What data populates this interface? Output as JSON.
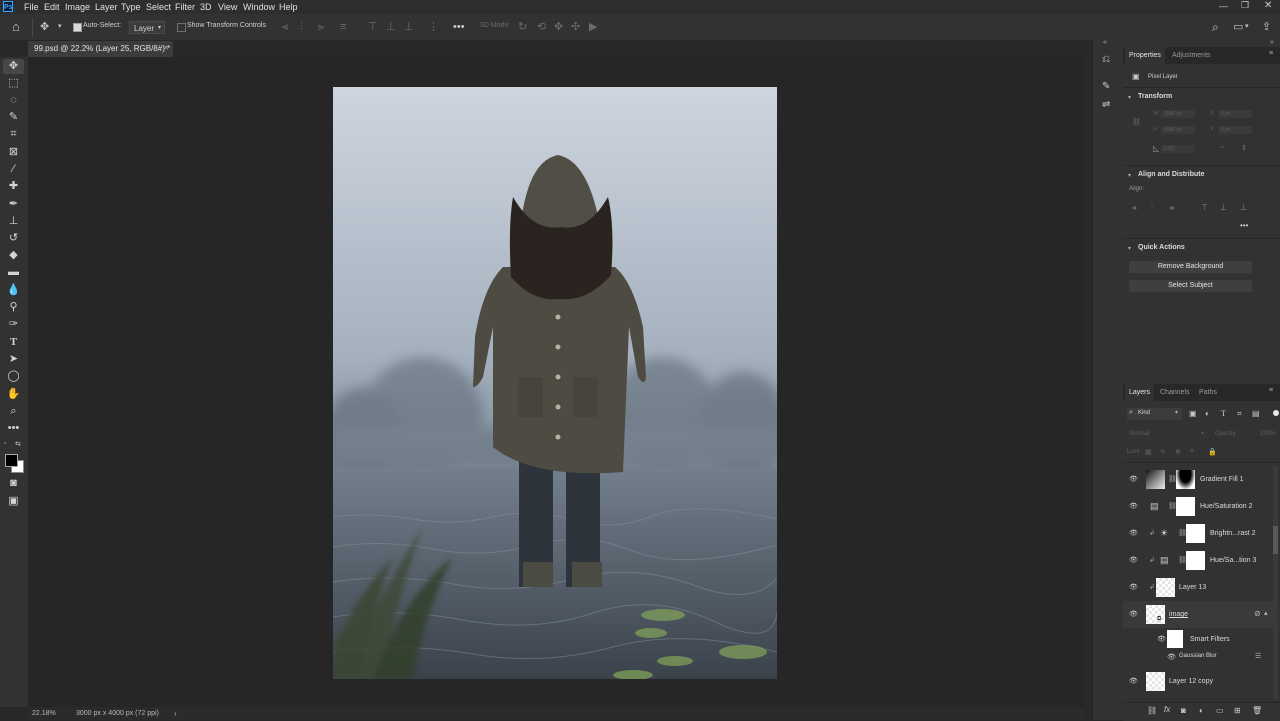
{
  "app": {
    "logo_text": "Ps"
  },
  "menu": [
    "File",
    "Edit",
    "Image",
    "Layer",
    "Type",
    "Select",
    "Filter",
    "3D",
    "View",
    "Window",
    "Help"
  ],
  "options_bar": {
    "auto_select_label": "Auto-Select:",
    "auto_select_target": "Layer",
    "show_transform_label": "Show Transform Controls",
    "three_d_mode_label": "3D Mode:"
  },
  "document": {
    "tab_title": "99.psd @ 22.2% (Layer 25, RGB/8#) *",
    "zoom_readout": "22.18%",
    "doc_size_readout": "3000 px x 4000 px (72 ppi)"
  },
  "properties_panel": {
    "tabs": [
      "Properties",
      "Adjustments"
    ],
    "layer_kind": "Pixel Layer",
    "transform_title": "Transform",
    "w_label": "W",
    "w_value": "3000 px",
    "h_label": "H",
    "h_value": "4000 px",
    "x_label": "X",
    "x_value": "0 px",
    "y_label": "Y",
    "y_value": "0 px",
    "angle_value": "0.00°",
    "align_title": "Align and Distribute",
    "align_label": "Align:",
    "quick_actions_title": "Quick Actions",
    "remove_bg_label": "Remove Background",
    "select_subject_label": "Select Subject"
  },
  "layers_panel": {
    "tabs": [
      "Layers",
      "Channels",
      "Paths"
    ],
    "filter_kind": "Kind",
    "blend_mode": "Normal",
    "opacity_label": "Opacity:",
    "opacity_value": "100%",
    "lock_label": "Lock:",
    "layers": [
      {
        "name": "Gradient Fill 1"
      },
      {
        "name": "Hue/Saturation 2"
      },
      {
        "name": "Brightn...rast 2"
      },
      {
        "name": "Hue/Sa...tion 3"
      },
      {
        "name": "Layer 13"
      },
      {
        "name": "image"
      },
      {
        "name": "Smart Filters"
      },
      {
        "name": "Gaussian Blur"
      },
      {
        "name": "Layer 12 copy"
      }
    ]
  },
  "colors": {
    "panel_bg": "#323232",
    "canvas_bg": "#262626",
    "accent": "#31a8ff"
  }
}
